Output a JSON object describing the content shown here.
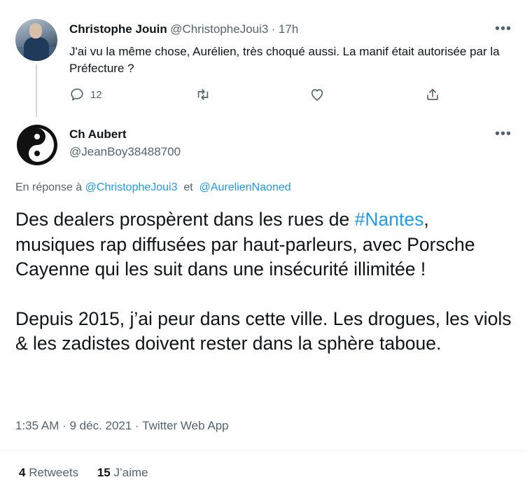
{
  "reply_tweet": {
    "name": "Christophe Jouin",
    "handle": "@ChristopheJoui3",
    "time_sep": "·",
    "time": "17h",
    "more": "•••",
    "text": "J'ai vu la même chose, Aurélien, très choqué aussi. La manif était autorisée par la Préfecture ?",
    "reply_count": "12"
  },
  "main_tweet": {
    "name": "Ch Aubert",
    "handle": "@JeanBoy38488700",
    "more": "•••",
    "reply_to_prefix": "En réponse à",
    "reply_to_user1": "@ChristopheJoui3",
    "reply_to_and": "et",
    "reply_to_user2": "@AurelienNaoned",
    "para1_before": "Des dealers prospèrent dans les rues de ",
    "hashtag": "#Nantes",
    "para1_after": ", musiques rap diffusées par haut-parleurs, avec Porsche Cayenne qui les suit dans une insécurité illimitée !",
    "para2": "Depuis 2015, j’ai peur dans cette ville. Les drogues, les viols & les zadistes doivent rester dans la sphère taboue.",
    "meta": "1:35 AM · 9 déc. 2021 · Twitter Web App",
    "retweets_count": "4",
    "retweets_label": "Retweets",
    "likes_count": "15",
    "likes_label": "J’aime"
  },
  "icons": {
    "reply": "reply-icon",
    "retweet": "retweet-icon",
    "like": "heart-icon",
    "share": "share-icon"
  }
}
